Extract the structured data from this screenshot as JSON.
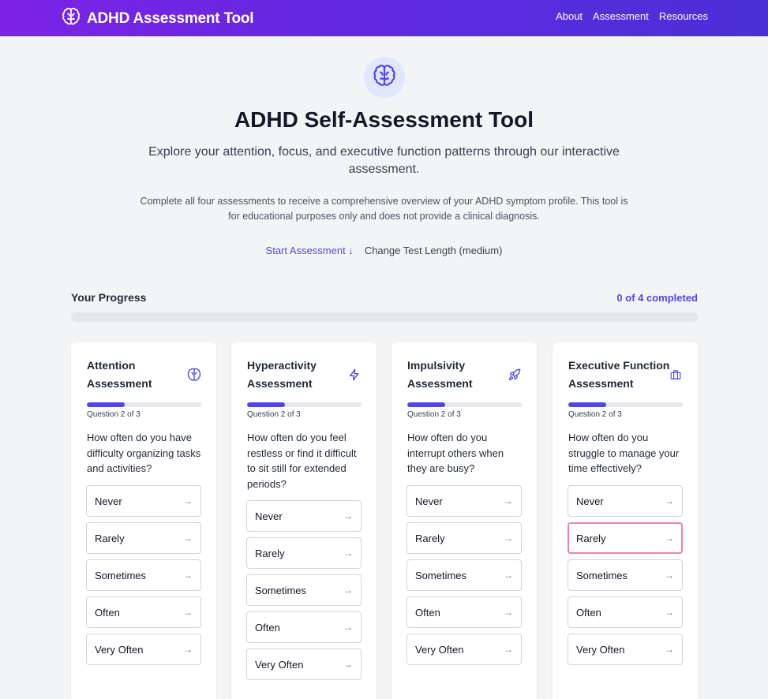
{
  "header": {
    "title": "ADHD Assessment Tool",
    "nav": [
      "About",
      "Assessment",
      "Resources"
    ]
  },
  "hero": {
    "title": "ADHD Self-Assessment Tool",
    "subtitle": "Explore your attention, focus, and executive function patterns through our interactive assessment.",
    "note": "Complete all four assessments to receive a comprehensive overview of your ADHD symptom profile. This tool is for educational purposes only and does not provide a clinical diagnosis.",
    "start_label": "Start Assessment ↓",
    "length_label": "Change Test Length (medium)"
  },
  "progress": {
    "label": "Your Progress",
    "count_text": "0 of 4 completed",
    "completed": 0,
    "total": 4
  },
  "colors": {
    "accent": "#4f46e5",
    "header_start": "#7c22e6",
    "header_end": "#4a2fd6",
    "selected_border": "#f07fb4"
  },
  "cards": [
    {
      "title": "Attention Assessment",
      "icon": "brain-icon",
      "question_count": "Question 2 of 3",
      "progress_fraction": 0.333,
      "question": "How often do you have difficulty organizing tasks and activities?",
      "options": [
        "Never",
        "Rarely",
        "Sometimes",
        "Often",
        "Very Often"
      ],
      "selected": null
    },
    {
      "title": "Hyperactivity Assessment",
      "icon": "lightning-icon",
      "question_count": "Question 2 of 3",
      "progress_fraction": 0.333,
      "question": "How often do you feel restless or find it difficult to sit still for extended periods?",
      "options": [
        "Never",
        "Rarely",
        "Sometimes",
        "Often",
        "Very Often"
      ],
      "selected": null
    },
    {
      "title": "Impulsivity Assessment",
      "icon": "rocket-icon",
      "question_count": "Question 2 of 3",
      "progress_fraction": 0.333,
      "question": "How often do you interrupt others when they are busy?",
      "options": [
        "Never",
        "Rarely",
        "Sometimes",
        "Often",
        "Very Often"
      ],
      "selected": null
    },
    {
      "title": "Executive Function Assessment",
      "icon": "briefcase-icon",
      "question_count": "Question 2 of 3",
      "progress_fraction": 0.333,
      "question": "How often do you struggle to manage your time effectively?",
      "options": [
        "Never",
        "Rarely",
        "Sometimes",
        "Often",
        "Very Often"
      ],
      "selected": "Rarely"
    }
  ]
}
